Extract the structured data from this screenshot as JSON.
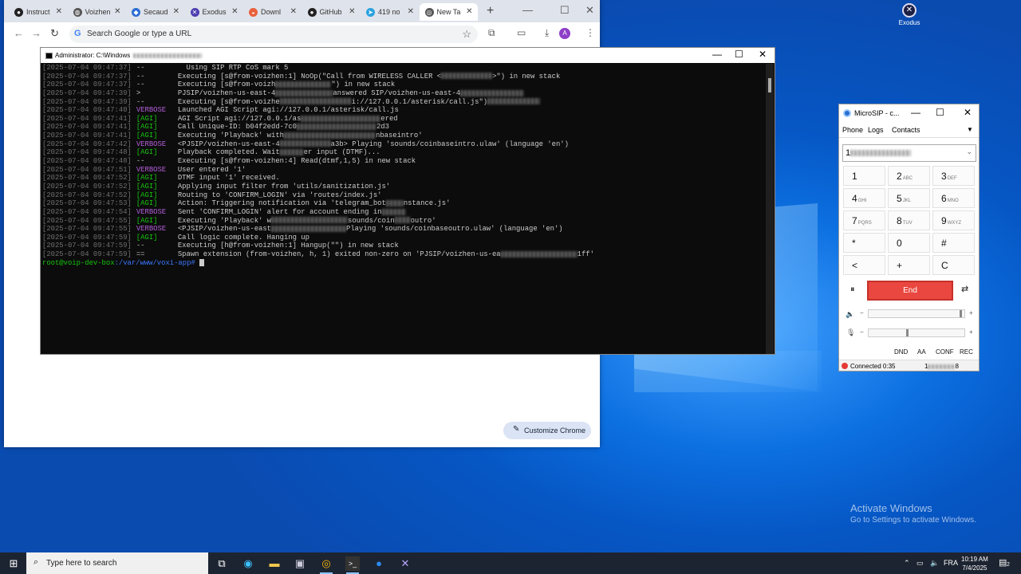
{
  "desktop": {
    "exodus_icon_label": "Exodus",
    "activate_title": "Activate Windows",
    "activate_sub": "Go to Settings to activate Windows."
  },
  "chrome": {
    "tabs": [
      {
        "label": "Instruct",
        "icon": "github-icon"
      },
      {
        "label": "Voizhen",
        "icon": "globe-icon"
      },
      {
        "label": "Secaud",
        "icon": "bookmark-icon"
      },
      {
        "label": "Exodus",
        "icon": "exodus-icon"
      },
      {
        "label": "Downl",
        "icon": "download-icon"
      },
      {
        "label": "GitHub",
        "icon": "github-icon"
      },
      {
        "label": "419 no",
        "icon": "telegram-icon"
      },
      {
        "label": "New Ta",
        "icon": "chrome-icon"
      }
    ],
    "omnibox_placeholder": "Search Google or type a URL",
    "profile_initial": "A",
    "customize_label": "Customize Chrome"
  },
  "terminal": {
    "title": "Administrator: C:\\Windows",
    "lines": [
      {
        "ts": "[2025-07-04 09:47:37]",
        "lvl": "--",
        "cls": "dash",
        "pre": "  Using SIP RTP CoS mark 5",
        "blur": 0,
        "post": ""
      },
      {
        "ts": "[2025-07-04 09:47:37]",
        "lvl": "--",
        "cls": "dash",
        "pre": "Executing [s@from-voizhen:1] NoOp(\"Call from WIRELESS CALLER <",
        "blur": 64,
        "post": ">\") in new stack"
      },
      {
        "ts": "[2025-07-04 09:47:37]",
        "lvl": "--",
        "cls": "dash",
        "pre": "Executing [s@from-voizh",
        "blur": 70,
        "post": "\") in new stack"
      },
      {
        "ts": "[2025-07-04 09:47:39]",
        "lvl": ">",
        "cls": "arrow",
        "pre": "PJSIP/voizhen-us-east-4",
        "blur": 72,
        "post": "answered SIP/voizhen-us-east-4",
        "blur2": 80
      },
      {
        "ts": "[2025-07-04 09:47:39]",
        "lvl": "--",
        "cls": "dash",
        "pre": "Executing [s@from-voizhe",
        "blur": 90,
        "post": "i://127.0.0.1/asterisk/call.js\")",
        "blur2": 66
      },
      {
        "ts": "[2025-07-04 09:47:40]",
        "lvl": "VERBOSE",
        "cls": "verbose",
        "pre": "Launched AGI Script agi://127.0.0.1/asterisk/call.js",
        "blur": 0,
        "post": ""
      },
      {
        "ts": "[2025-07-04 09:47:41]",
        "lvl": "[AGI]",
        "cls": "agi",
        "pre": "AGI Script agi://127.0.0.1/as",
        "blur": 100,
        "post": "ered"
      },
      {
        "ts": "[2025-07-04 09:47:41]",
        "lvl": "[AGI]",
        "cls": "agi",
        "pre": "Call Unique-ID: b04f2edd-7c0",
        "blur": 100,
        "post": "2d3"
      },
      {
        "ts": "[2025-07-04 09:47:41]",
        "lvl": "[AGI]",
        "cls": "agi",
        "pre": "Executing 'Playback' with",
        "blur": 115,
        "post": "nbaseintro'"
      },
      {
        "ts": "[2025-07-04 09:47:42]",
        "lvl": "VERBOSE",
        "cls": "verbose",
        "pre": "<PJSIP/voizhen-us-east-4",
        "blur": 64,
        "post": "a3b> Playing 'sounds/coinbaseintro.ulaw' (language 'en')"
      },
      {
        "ts": "[2025-07-04 09:47:48]",
        "lvl": "[AGI]",
        "cls": "agi",
        "pre": "Playback completed. Wait",
        "blur": 30,
        "post": "er input (DTMF)..."
      },
      {
        "ts": "[2025-07-04 09:47:48]",
        "lvl": "--",
        "cls": "dash",
        "pre": "Executing [s@from-voizhen:4] Read(dtmf,1,5) in new stack",
        "blur": 0,
        "post": ""
      },
      {
        "ts": "[2025-07-04 09:47:51]",
        "lvl": "VERBOSE",
        "cls": "verbose",
        "pre": "User entered '1'",
        "blur": 0,
        "post": ""
      },
      {
        "ts": "[2025-07-04 09:47:52]",
        "lvl": "[AGI]",
        "cls": "agi",
        "pre": "DTMF input '1' received.",
        "blur": 0,
        "post": ""
      },
      {
        "ts": "[2025-07-04 09:47:52]",
        "lvl": "[AGI]",
        "cls": "agi",
        "pre": "Applying input filter from 'utils/sanitization.js'",
        "blur": 0,
        "post": ""
      },
      {
        "ts": "[2025-07-04 09:47:52]",
        "lvl": "[AGI]",
        "cls": "agi",
        "pre": "Routing to 'CONFIRM_LOGIN' via 'routes/index.js'",
        "blur": 0,
        "post": ""
      },
      {
        "ts": "[2025-07-04 09:47:53]",
        "lvl": "[AGI]",
        "cls": "agi",
        "pre": "Action: Triggering notification via 'telegram_bot",
        "blur": 22,
        "post": "nstance.js'"
      },
      {
        "ts": "[2025-07-04 09:47:54]",
        "lvl": "VERBOSE",
        "cls": "verbose",
        "pre": "Sent 'CONFIRM_LOGIN' alert for account ending in",
        "blur": 30,
        "post": ""
      },
      {
        "ts": "[2025-07-04 09:47:55]",
        "lvl": "[AGI]",
        "cls": "agi",
        "pre": "Executing 'Playback' w",
        "blur": 96,
        "post": "sounds/coin",
        "blur2": 20,
        "post2": "outro'"
      },
      {
        "ts": "[2025-07-04 09:47:55]",
        "lvl": "VERBOSE",
        "cls": "verbose",
        "pre": "<PJSIP/voizhen-us-east",
        "blur": 94,
        "post": "Playing 'sounds/coinbaseoutro.ulaw' (language 'en')"
      },
      {
        "ts": "[2025-07-04 09:47:59]",
        "lvl": "[AGI]",
        "cls": "agi",
        "pre": "Call logic complete. Hanging up",
        "blur": 0,
        "post": ""
      },
      {
        "ts": "[2025-07-04 09:47:59]",
        "lvl": "--",
        "cls": "dash",
        "pre": "Executing [h@from-voizhen:1] Hangup(\"\") in new stack",
        "blur": 0,
        "post": ""
      },
      {
        "ts": "[2025-07-04 09:47:59]",
        "lvl": "==",
        "cls": "dash",
        "pre": "Spawn extension (from-voizhen, h, 1) exited non-zero on 'PJSIP/voizhen-us-ea",
        "blur": 96,
        "post": "1ff'"
      }
    ],
    "prompt_user": "root@voip-dev-box",
    "prompt_path": ":/var/www/voxi-app#"
  },
  "microsip": {
    "title": "MicroSIP - c...",
    "tabs": [
      "Phone",
      "Logs",
      "Contacts"
    ],
    "number_prefix": "1",
    "keys": [
      {
        "k": "1",
        "sub": ""
      },
      {
        "k": "2",
        "sub": "ABC"
      },
      {
        "k": "3",
        "sub": "DEF"
      },
      {
        "k": "4",
        "sub": "GHI"
      },
      {
        "k": "5",
        "sub": "JKL"
      },
      {
        "k": "6",
        "sub": "MNO"
      },
      {
        "k": "7",
        "sub": "PQRS"
      },
      {
        "k": "8",
        "sub": "TUV"
      },
      {
        "k": "9",
        "sub": "WXYZ"
      },
      {
        "k": "*",
        "sub": ""
      },
      {
        "k": "0",
        "sub": ""
      },
      {
        "k": "#",
        "sub": ""
      },
      {
        "k": "<",
        "sub": ""
      },
      {
        "k": "+",
        "sub": ""
      },
      {
        "k": "C",
        "sub": ""
      }
    ],
    "end_label": "End",
    "speaker_volume": 0.97,
    "mic_volume": 0.4,
    "func_buttons": [
      "DND",
      "AA",
      "CONF",
      "REC"
    ],
    "status_text": "Connected 0:35",
    "status_number_prefix": "1",
    "status_number_suffix": "8"
  },
  "taskbar": {
    "search_placeholder": "Type here to search",
    "language": "FRA",
    "time": "10:19 AM",
    "date": "7/4/2025",
    "notification_count": "2"
  }
}
